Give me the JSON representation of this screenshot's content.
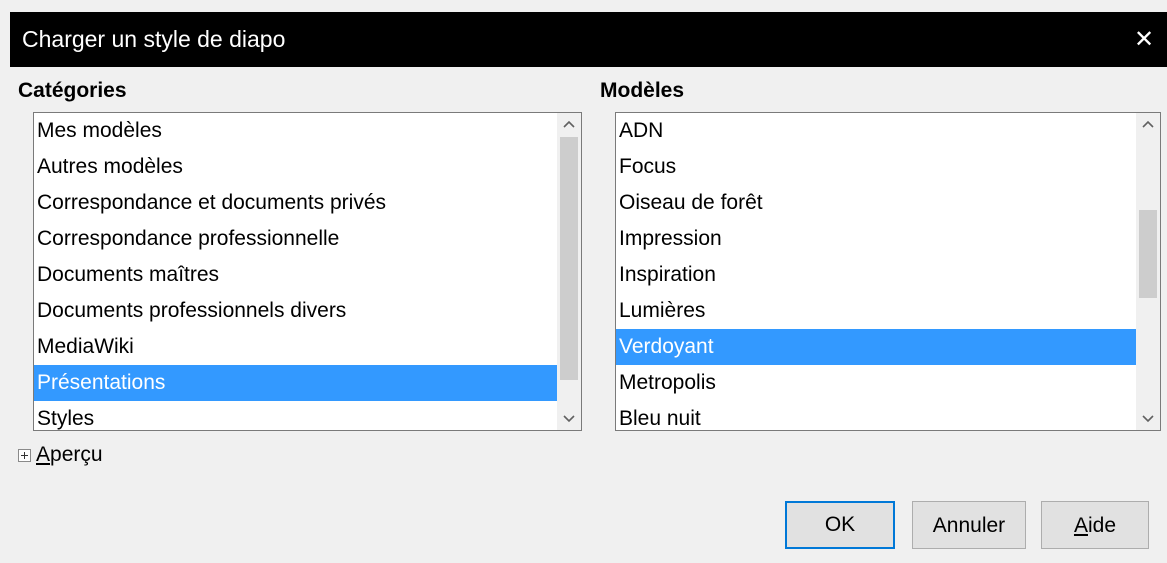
{
  "dialog": {
    "title": "Charger un style de diapo",
    "close_glyph": "✕"
  },
  "categories": {
    "label": "Catégories",
    "items": [
      "Mes modèles",
      "Autres modèles",
      "Correspondance et documents privés",
      "Correspondance professionnelle",
      "Documents maîtres",
      "Documents professionnels divers",
      "MediaWiki",
      "Présentations",
      "Styles"
    ],
    "selected_index": 7
  },
  "templates": {
    "label": "Modèles",
    "items": [
      "ADN",
      "Focus",
      "Oiseau de forêt",
      "Impression",
      "Inspiration",
      "Lumières",
      "Verdoyant",
      "Metropolis",
      "Bleu nuit"
    ],
    "selected_index": 6
  },
  "preview": {
    "mnemonic": "A",
    "rest": "perçu",
    "expander_icon": "plus-box-icon"
  },
  "buttons": {
    "ok": "OK",
    "cancel": "Annuler",
    "help_mnemonic": "A",
    "help_rest": "ide"
  },
  "colors": {
    "title_bar": "#000000",
    "selection": "#3399ff",
    "default_button_border": "#0078d7",
    "dialog_bg": "#f0f0f0"
  }
}
